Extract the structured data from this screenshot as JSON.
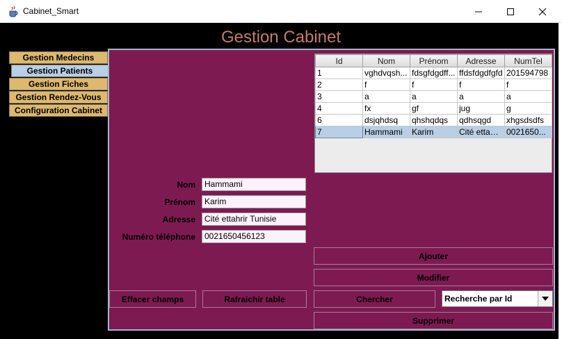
{
  "window": {
    "title": "Cabinet_Smart"
  },
  "header": {
    "title": "Gestion Cabinet"
  },
  "tabs": [
    {
      "label": "Gestion Medecins",
      "active": false
    },
    {
      "label": "Gestion Patients",
      "active": true
    },
    {
      "label": "Gestion Fiches",
      "active": false
    },
    {
      "label": "Gestion Rendez-Vous",
      "active": false
    },
    {
      "label": "Configuration Cabinet",
      "active": false
    }
  ],
  "table": {
    "columns": [
      "Id",
      "Nom",
      "Prénom",
      "Adresse",
      "NumTel"
    ],
    "rows": [
      [
        "1",
        "vghdvqsh...",
        "fdsgfdgdff...",
        "ffdsfdgdfgfd",
        "201594798"
      ],
      [
        "2",
        "f",
        "f",
        "f",
        "f"
      ],
      [
        "3",
        "a",
        "a",
        "a",
        "a"
      ],
      [
        "4",
        "fx",
        "gf",
        "jug",
        "g"
      ],
      [
        "6",
        "dsjqhdsq",
        "qhshqdqs",
        "qdhsqgd",
        "xhgsdsdfs"
      ],
      [
        "7",
        "Hammami",
        "Karim",
        "Cité ettahr...",
        "0021650..."
      ]
    ],
    "selected_row": 5
  },
  "form": {
    "nom": {
      "label": "Nom",
      "value": "Hammami"
    },
    "prenom": {
      "label": "Prénom",
      "value": "Karim"
    },
    "adresse": {
      "label": "Adresse",
      "value": "Cité ettahrir Tunisie"
    },
    "telephone": {
      "label": "Numéro téléphone",
      "value": "0021650456123"
    }
  },
  "buttons": {
    "ajouter": "Ajouter",
    "modifier": "Modifier",
    "effacer": "Effacer champs",
    "rafraichir": "Rafraichir table",
    "chercher": "Chercher",
    "supprimer": "Supprimer"
  },
  "search": {
    "selected": "Recherche par Id"
  },
  "colors": {
    "panel": "#7e1a52",
    "tab": "#ddb86f",
    "tab_active": "#b8cfe5",
    "header_text": "#c27b72",
    "selected_row": "#b8cfe5"
  },
  "icons": {
    "app": "java-cup-icon",
    "minimize": "minimize-icon",
    "maximize": "maximize-icon",
    "close": "close-icon",
    "dropdown": "chevron-down-icon"
  }
}
